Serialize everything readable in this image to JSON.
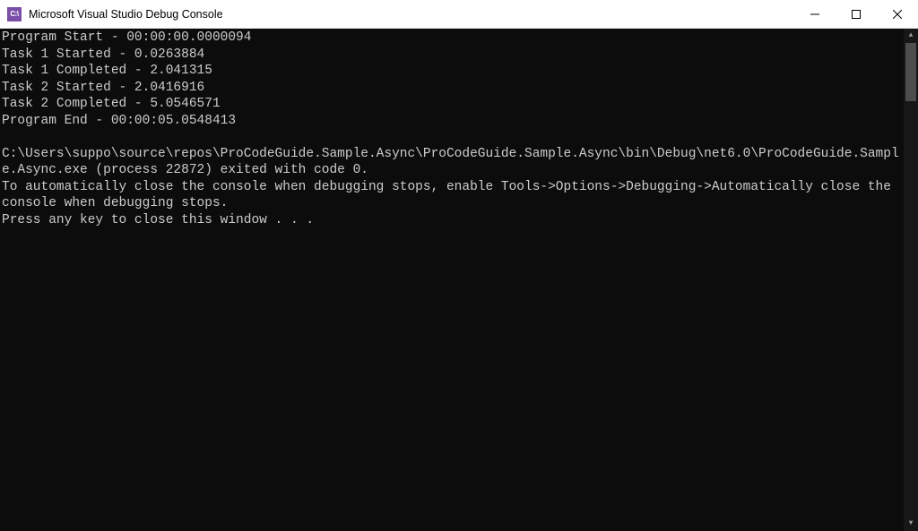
{
  "window": {
    "app_icon_text": "C:\\",
    "title": "Microsoft Visual Studio Debug Console"
  },
  "console": {
    "lines": [
      "Program Start - 00:00:00.0000094",
      "Task 1 Started - 0.0263884",
      "Task 1 Completed - 2.041315",
      "Task 2 Started - 2.0416916",
      "Task 2 Completed - 5.0546571",
      "Program End - 00:00:05.0548413",
      "",
      "C:\\Users\\suppo\\source\\repos\\ProCodeGuide.Sample.Async\\ProCodeGuide.Sample.Async\\bin\\Debug\\net6.0\\ProCodeGuide.Sample.Async.exe (process 22872) exited with code 0.",
      "To automatically close the console when debugging stops, enable Tools->Options->Debugging->Automatically close the console when debugging stops.",
      "Press any key to close this window . . ."
    ]
  }
}
